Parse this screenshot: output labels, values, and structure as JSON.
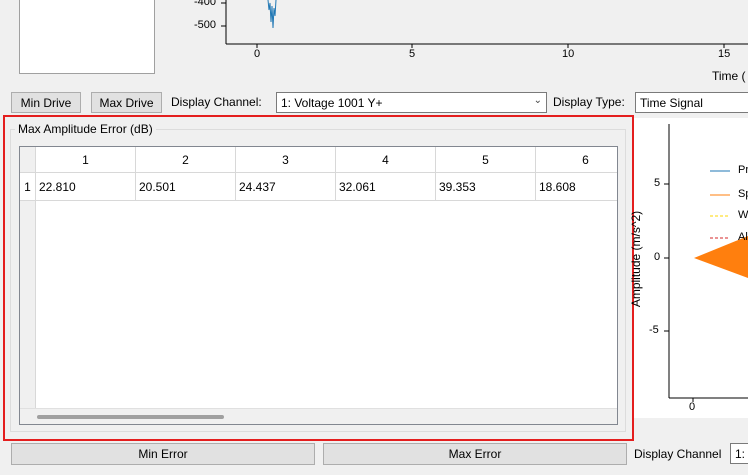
{
  "top_chart": {
    "y_ticks": [
      "-400",
      "-500"
    ],
    "x_ticks": [
      "0",
      "5",
      "10",
      "15"
    ],
    "x_label": "Time ("
  },
  "toolbar": {
    "min_drive": "Min Drive",
    "max_drive": "Max Drive",
    "display_channel_label": "Display Channel:",
    "display_channel_value": "1: Voltage 1001 Y+",
    "display_type_label": "Display Type:",
    "display_type_value": "Time Signal"
  },
  "error_panel": {
    "title": "Max Amplitude Error (dB)",
    "columns": [
      "1",
      "2",
      "3",
      "4",
      "5",
      "6"
    ],
    "rows": [
      {
        "header": "1",
        "cells": [
          "22.810",
          "20.501",
          "24.437",
          "32.061",
          "39.353",
          "18.608"
        ]
      }
    ]
  },
  "right_chart": {
    "y_label": "Amplitude (m/s^2)",
    "y_ticks": [
      "5",
      "0",
      "-5"
    ],
    "x_ticks": [
      "0"
    ],
    "legend": [
      "Pr",
      "Sp",
      "W",
      "Al"
    ],
    "colors": {
      "pr": "#1f77b4",
      "sp": "#ff7f0e",
      "w": "#ffd700",
      "al": "#d62728"
    }
  },
  "bottom_bar": {
    "min_error": "Min Error",
    "max_error": "Max Error",
    "display_channel_label": "Display Channel",
    "display_channel_value": "1:"
  },
  "highlight_color": "#e41e1e"
}
